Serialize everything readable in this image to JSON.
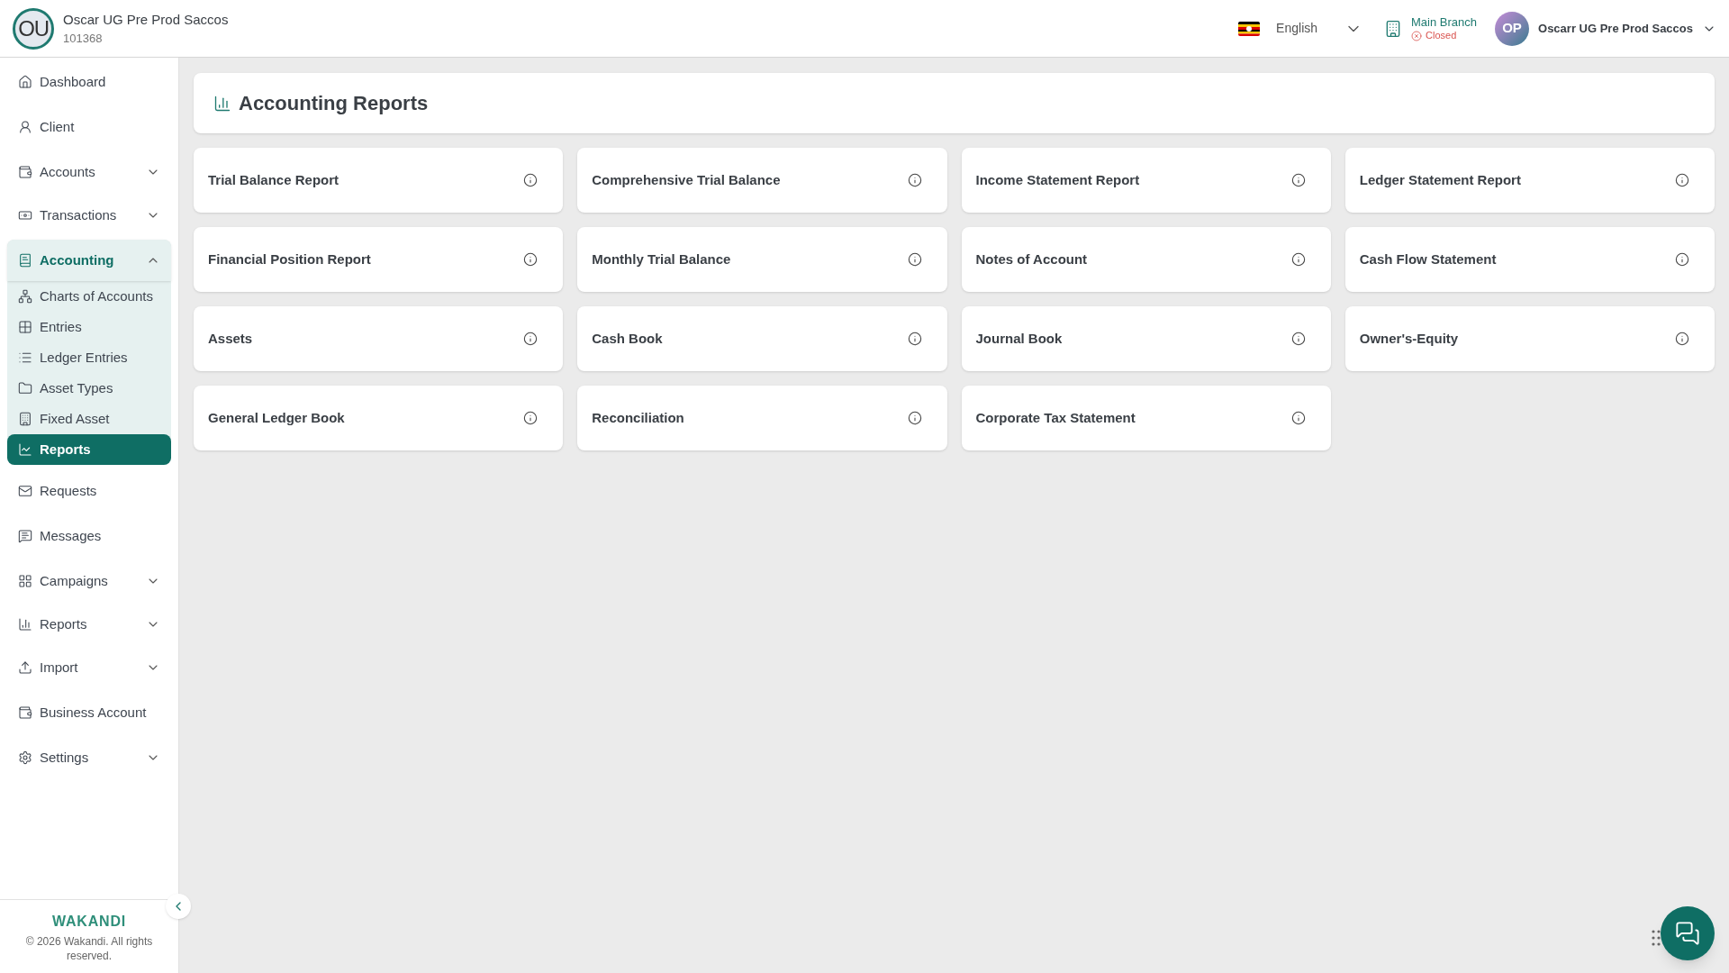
{
  "org": {
    "initials": "OU",
    "name": "Oscar UG Pre Prod Saccos",
    "code": "101368"
  },
  "topbar": {
    "language": "English",
    "branch": "Main Branch",
    "branch_status": "Closed",
    "user_initials": "OP",
    "user_name": "Oscarr UG Pre Prod Saccos"
  },
  "sidebar": {
    "items": [
      {
        "kind": "link",
        "label": "Dashboard",
        "selected": false
      },
      {
        "kind": "link",
        "label": "Client",
        "selected": false
      },
      {
        "kind": "group",
        "label": "Accounts",
        "expanded": false
      },
      {
        "kind": "group",
        "label": "Transactions",
        "expanded": false
      },
      {
        "kind": "group",
        "label": "Accounting",
        "expanded": true,
        "children": [
          {
            "label": "Charts of Accounts",
            "selected": false
          },
          {
            "label": "Entries",
            "selected": false
          },
          {
            "label": "Ledger Entries",
            "selected": false
          },
          {
            "label": "Asset Types",
            "selected": false
          },
          {
            "label": "Fixed Asset",
            "selected": false
          },
          {
            "label": "Reports",
            "selected": true
          }
        ]
      },
      {
        "kind": "link",
        "label": "Requests",
        "selected": false
      },
      {
        "kind": "link",
        "label": "Messages",
        "selected": false
      },
      {
        "kind": "group",
        "label": "Campaigns",
        "expanded": false
      },
      {
        "kind": "group",
        "label": "Reports",
        "expanded": false
      },
      {
        "kind": "group",
        "label": "Import",
        "expanded": false
      },
      {
        "kind": "link",
        "label": "Business Account",
        "selected": false
      },
      {
        "kind": "group",
        "label": "Settings",
        "expanded": false
      }
    ]
  },
  "footer": {
    "brand": "WAKANDI",
    "copyright": "© 2026 Wakandi. All rights reserved."
  },
  "page": {
    "title": "Accounting Reports",
    "reports": [
      "Trial Balance Report",
      "Comprehensive Trial Balance",
      "Income Statement Report",
      "Ledger Statement Report",
      "Financial Position Report",
      "Monthly Trial Balance",
      "Notes of Account",
      "Cash Flow Statement",
      "Assets",
      "Cash Book",
      "Journal Book",
      "Owner's-Equity",
      "General Ledger Book",
      "Reconciliation",
      "Corporate Tax Statement"
    ]
  }
}
